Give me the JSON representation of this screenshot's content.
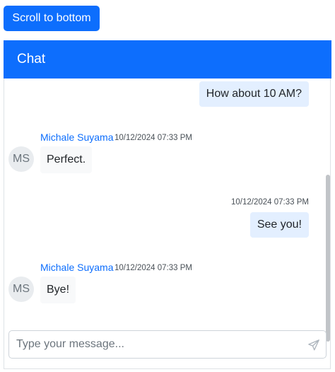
{
  "toolbar": {
    "scroll_label": "Scroll to bottom"
  },
  "chat": {
    "title": "Chat",
    "messages": [
      {
        "text": "How about 10 AM?"
      },
      {
        "author": "Michale Suyama",
        "initials": "MS",
        "time": "10/12/2024 07:33 PM",
        "text": "Perfect."
      },
      {
        "time": "10/12/2024 07:33 PM",
        "text": "See you!"
      },
      {
        "author": "Michale Suyama",
        "initials": "MS",
        "time": "10/12/2024 07:33 PM",
        "text": "Bye!"
      }
    ],
    "composer": {
      "placeholder": "Type your message...",
      "value": ""
    },
    "icons": {
      "send": "send-icon"
    }
  },
  "colors": {
    "primary": "#0d6efd",
    "outgoing_bubble": "#e3efff",
    "incoming_bubble": "#f8f9fa",
    "avatar_bg": "#e9ecef"
  }
}
